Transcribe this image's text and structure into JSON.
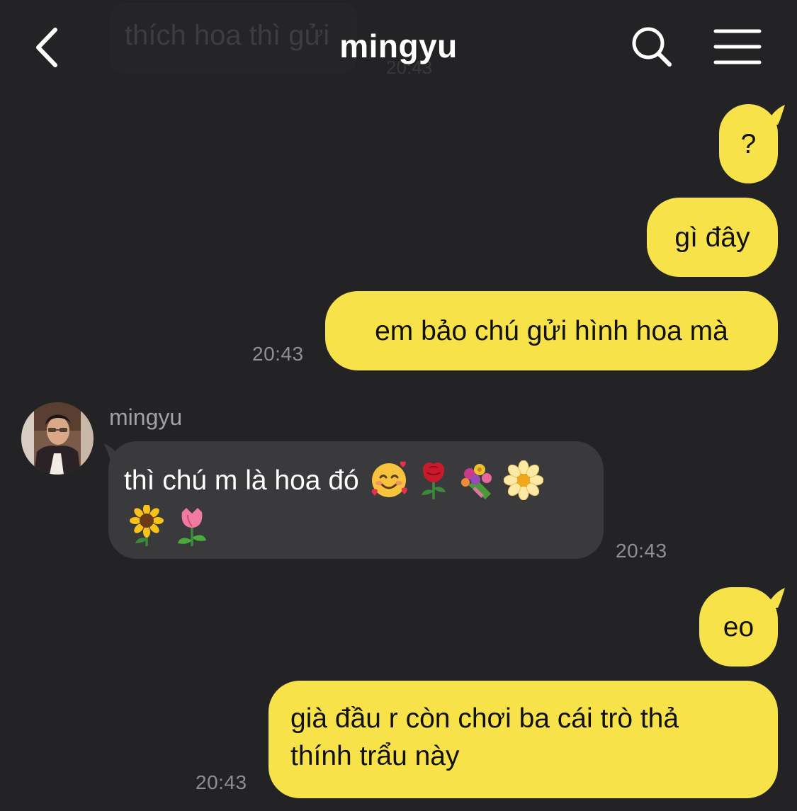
{
  "header": {
    "title": "mingyu",
    "ghost_preview_text": "thích hoa thì gửi",
    "ghost_preview_time": "20:43"
  },
  "messages": [
    {
      "from": "me",
      "text": "?"
    },
    {
      "from": "me",
      "text": "gì đây"
    },
    {
      "from": "me",
      "text": "em bảo chú gửi hình hoa mà",
      "time": "20:43"
    },
    {
      "from": "them",
      "sender": "mingyu",
      "line1": "thì chú m là hoa đó",
      "emojis": [
        "smiling-face-with-hearts",
        "rose",
        "bouquet",
        "blossom",
        "sunflower",
        "tulip"
      ],
      "time": "20:43"
    },
    {
      "from": "me",
      "text": "eo"
    },
    {
      "from": "me",
      "line1": "già đầu r còn chơi ba cái trò thả",
      "line2": "thính trẩu này",
      "time": "20:43"
    }
  ],
  "colors": {
    "background": "#232325",
    "my_bubble": "#f8e24a",
    "their_bubble": "#3a3a3c",
    "timestamp": "#8e8e93"
  },
  "icons": [
    "chevron-left-icon",
    "search-icon",
    "menu-icon"
  ]
}
